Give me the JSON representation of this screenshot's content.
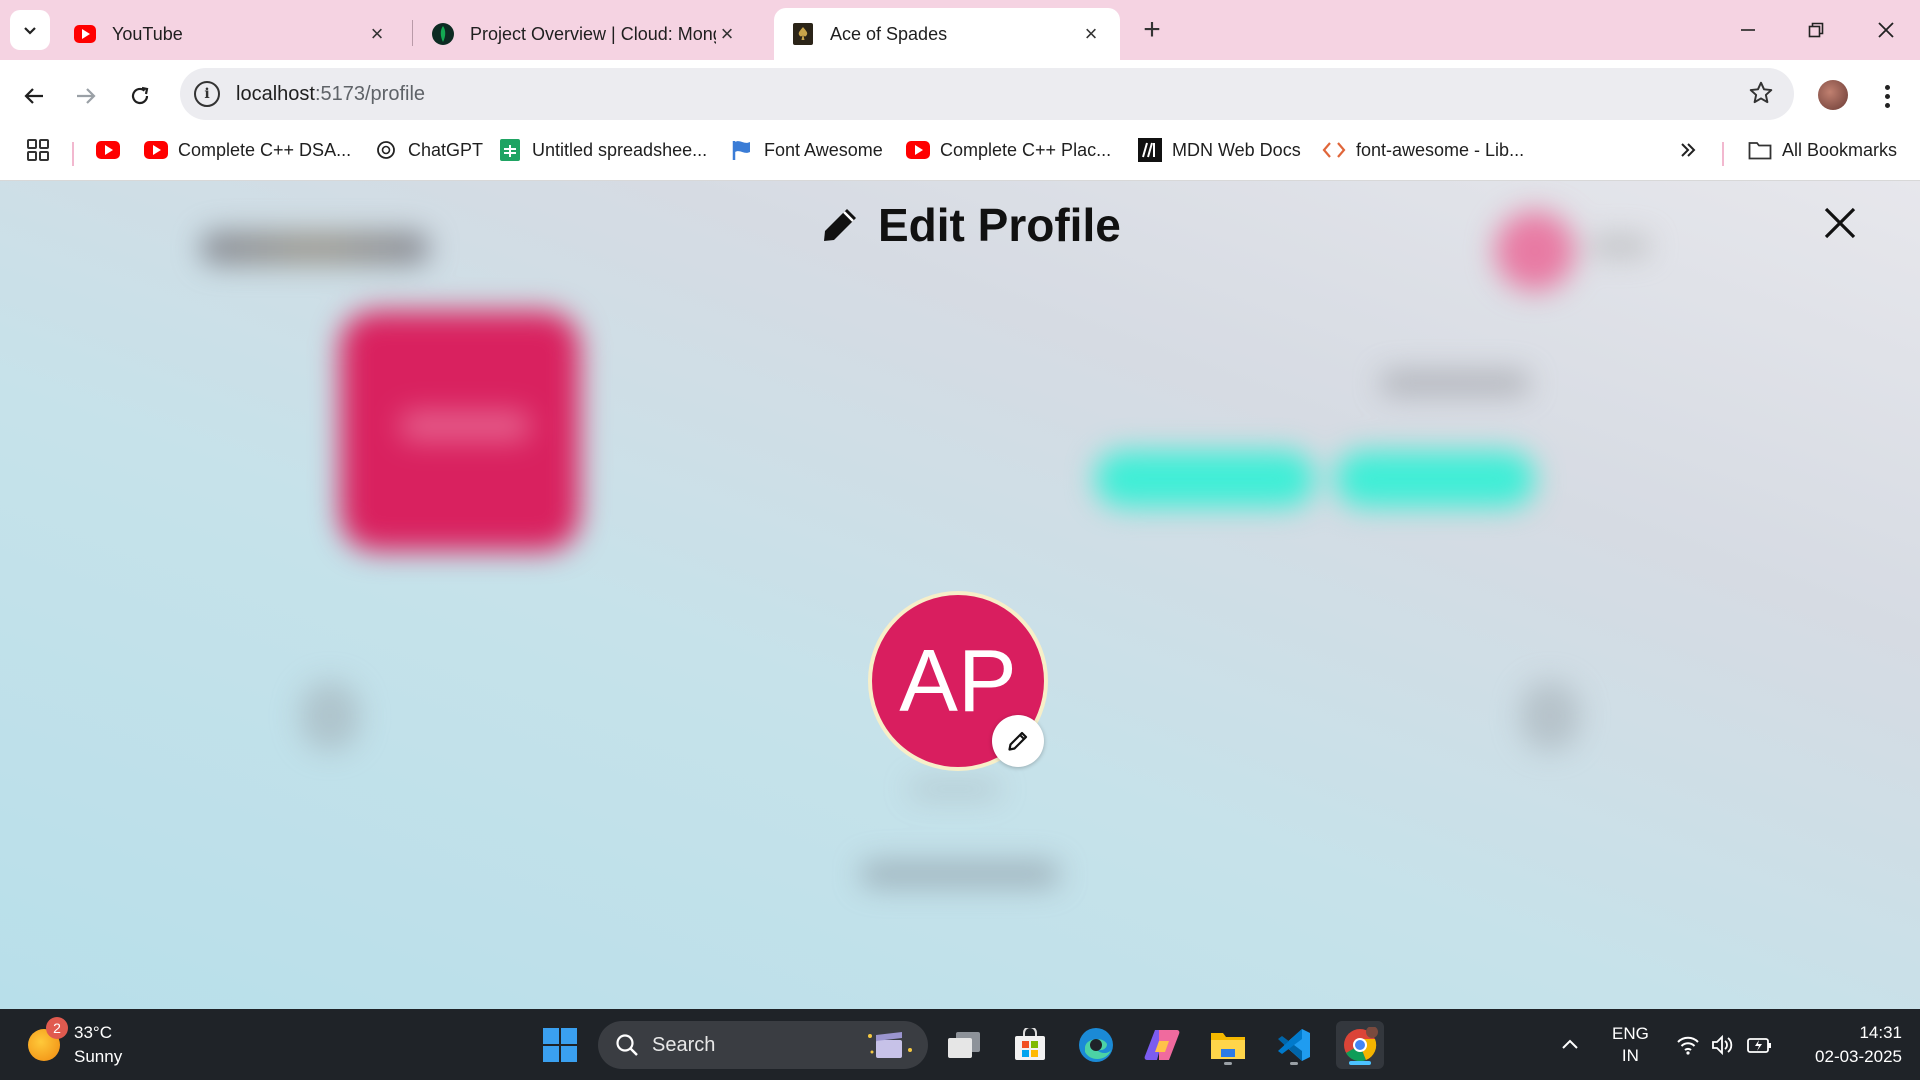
{
  "browser": {
    "tabs": [
      {
        "title": "YouTube",
        "icon": "youtube-icon",
        "active": false
      },
      {
        "title": "Project Overview | Cloud: MongoDB Cloud",
        "icon": "mongodb-icon",
        "active": false
      },
      {
        "title": "Ace of Spades",
        "icon": "ace-of-spades-icon",
        "active": true
      }
    ],
    "address": {
      "host": "localhost",
      "path": ":5173/profile"
    },
    "bookmarks": [
      {
        "label": "",
        "icon": "youtube-icon"
      },
      {
        "label": "Complete C++ DSA...",
        "icon": "youtube-icon"
      },
      {
        "label": "ChatGPT",
        "icon": "chatgpt-icon"
      },
      {
        "label": "Untitled spreadshee...",
        "icon": "sheets-icon"
      },
      {
        "label": "Font Awesome",
        "icon": "font-awesome-flag-icon"
      },
      {
        "label": "Complete C++ Plac...",
        "icon": "youtube-icon"
      },
      {
        "label": "MDN Web Docs",
        "icon": "mdn-icon"
      },
      {
        "label": "font-awesome - Lib...",
        "icon": "code-icon"
      }
    ],
    "all_bookmarks": "All Bookmarks"
  },
  "modal": {
    "title": "Edit Profile",
    "avatar_initials": "AP"
  },
  "colors": {
    "avatar_bg": "#d91e5f",
    "accent_teal": "#3eeed6",
    "tab_strip": "#f5d3e2"
  },
  "taskbar": {
    "weather": {
      "temp": "33°C",
      "condition": "Sunny",
      "badge": "2"
    },
    "search_placeholder": "Search",
    "language": {
      "lang": "ENG",
      "region": "IN"
    },
    "time": "14:31",
    "date": "02-03-2025"
  }
}
